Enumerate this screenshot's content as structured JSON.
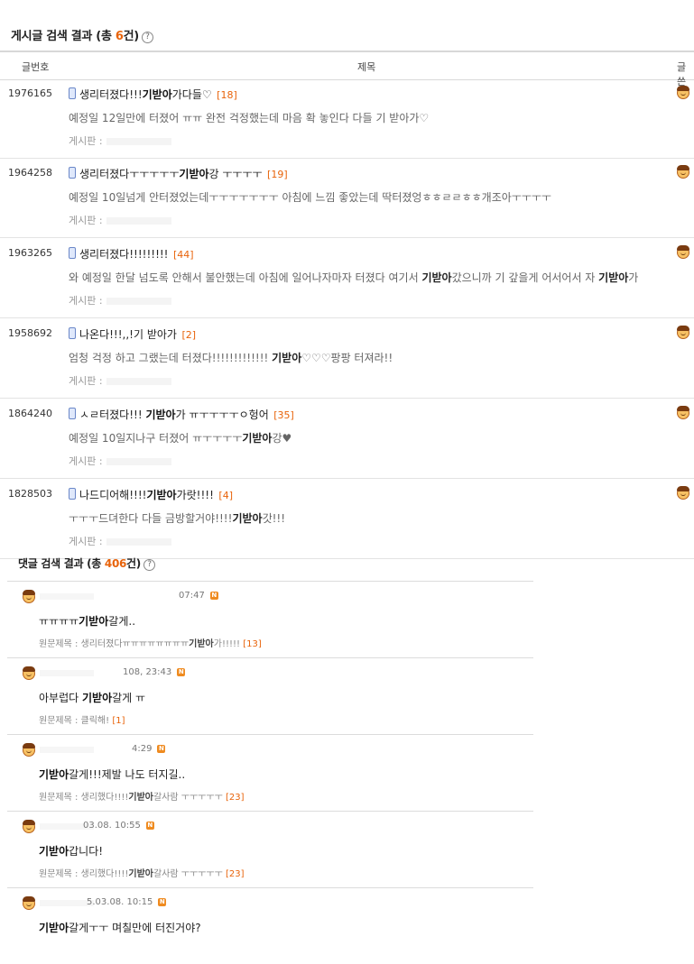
{
  "posts_section": {
    "title": "게시글 검색 결과 (총 ",
    "count": "6",
    "suffix": "건)",
    "help": "?"
  },
  "table_header": {
    "number": "글번호",
    "subject": "제목",
    "author": "글쓴"
  },
  "posts": [
    {
      "number": "1976165",
      "title": [
        {
          "t": "생리터졌다!!!"
        },
        {
          "t": "기받아",
          "b": true
        },
        {
          "t": "가다들♡"
        }
      ],
      "count": "[18]",
      "snippet": [
        {
          "t": "예정일 12일만에 터졌어 ㅠㅠ 완전 걱정했는데 마음 확 놓인다 다들 기 받아가♡"
        }
      ],
      "board": "게시판 :"
    },
    {
      "number": "1964258",
      "title": [
        {
          "t": "생리터졌다ㅜㅜㅜㅜㅜ"
        },
        {
          "t": "기받아",
          "b": true
        },
        {
          "t": "강 ㅜㅜㅜㅜ"
        }
      ],
      "count": "[19]",
      "snippet": [
        {
          "t": "예정일 10일넘게 안터졌었는데ㅜㅜㅜㅜㅜㅜㅜ 아침에 느낌 좋았는데 딱터졌엉ㅎㅎㄹㄹㅎㅎ개조아ㅜㅜㅜㅜ"
        }
      ],
      "board": "게시판 :"
    },
    {
      "number": "1963265",
      "title": [
        {
          "t": "생리터졌다!!!!!!!!!"
        }
      ],
      "count": "[44]",
      "snippet": [
        {
          "t": "와 예정일 한달 넘도록 안해서 불안했는데 아침에 일어나자마자 터졌다 여기서 "
        },
        {
          "t": "기받아",
          "b": true
        },
        {
          "t": "갔으니까 기 갚을게 어서어서 자 "
        },
        {
          "t": "기받아",
          "b": true
        },
        {
          "t": "가"
        }
      ],
      "board": "게시판 :"
    },
    {
      "number": "1958692",
      "title": [
        {
          "t": "나온다!!!,,!기 받아가"
        }
      ],
      "count": "[2]",
      "snippet": [
        {
          "t": "엄청 걱정 하고 그랬는데 터졌다!!!!!!!!!!!!! "
        },
        {
          "t": "기받아",
          "b": true
        },
        {
          "t": "♡♡♡팡팡 터져라!!"
        }
      ],
      "board": "게시판 :"
    },
    {
      "number": "1864240",
      "title": [
        {
          "t": "ㅅㄹ터졌다!!! "
        },
        {
          "t": "기받아",
          "b": true
        },
        {
          "t": "가 ㅠㅜㅜㅜㅜㅇ헝어"
        }
      ],
      "count": "[35]",
      "snippet": [
        {
          "t": "예정일 10일지나구 터졌어 ㅠㅜㅜㅜㅜ"
        },
        {
          "t": "기받아",
          "b": true
        },
        {
          "t": "강♥"
        }
      ],
      "board": "게시판 :"
    },
    {
      "number": "1828503",
      "title": [
        {
          "t": "나드디어해!!!!"
        },
        {
          "t": "기받아",
          "b": true
        },
        {
          "t": "가랏!!!!"
        }
      ],
      "count": "[4]",
      "snippet": [
        {
          "t": "ㅜㅜㅜ드뎌한다 다들 금방할거야!!!!"
        },
        {
          "t": "기받아",
          "b": true
        },
        {
          "t": "갓!!!"
        }
      ],
      "board": "게시판 :"
    }
  ],
  "comments_section": {
    "title": "댓글 검색 결과 (총 ",
    "count": "406",
    "suffix": "건)",
    "help": "?"
  },
  "comments": [
    {
      "date": "07:47",
      "badge": "N",
      "text": [
        {
          "t": "ㅠㅠㅠㅠ"
        },
        {
          "t": "기받아",
          "b": true
        },
        {
          "t": "갈게.."
        }
      ],
      "source": [
        {
          "t": "원문제목 : 생리터졌다ㅠㅠㅠㅠㅠㅠㅠㅠ"
        },
        {
          "t": "기받아",
          "b": true
        },
        {
          "t": "가!!!!! "
        }
      ],
      "count": "[13]"
    },
    {
      "date": "108, 23:43",
      "badge": "N",
      "text": [
        {
          "t": "아부럽다 "
        },
        {
          "t": "기받아",
          "b": true
        },
        {
          "t": "갈게 ㅠ"
        }
      ],
      "source": [
        {
          "t": "원문제목 : 클릭해! "
        }
      ],
      "count": "[1]"
    },
    {
      "date": "4:29",
      "badge": "N",
      "text": [
        {
          "t": "기받아",
          "b": true
        },
        {
          "t": "갈게!!!제발 나도 터지길.."
        }
      ],
      "source": [
        {
          "t": "원문제목 : 생리했다!!!!"
        },
        {
          "t": "기받아",
          "b": true
        },
        {
          "t": "갈사람 ㅜㅜㅜㅜㅜ "
        }
      ],
      "count": "[23]"
    },
    {
      "date": "03.08. 10:55",
      "badge": "N",
      "text": [
        {
          "t": "기받아",
          "b": true
        },
        {
          "t": "갑니다!"
        }
      ],
      "source": [
        {
          "t": "원문제목 : 생리했다!!!!"
        },
        {
          "t": "기받아",
          "b": true
        },
        {
          "t": "갈사람 ㅜㅜㅜㅜㅜ "
        }
      ],
      "count": "[23]"
    },
    {
      "date": "5.03.08. 10:15",
      "badge": "N",
      "text": [
        {
          "t": "기받아",
          "b": true
        },
        {
          "t": "갈게ㅜㅜ 며칠만에 터진거야?"
        }
      ],
      "source": [],
      "count": ""
    }
  ]
}
